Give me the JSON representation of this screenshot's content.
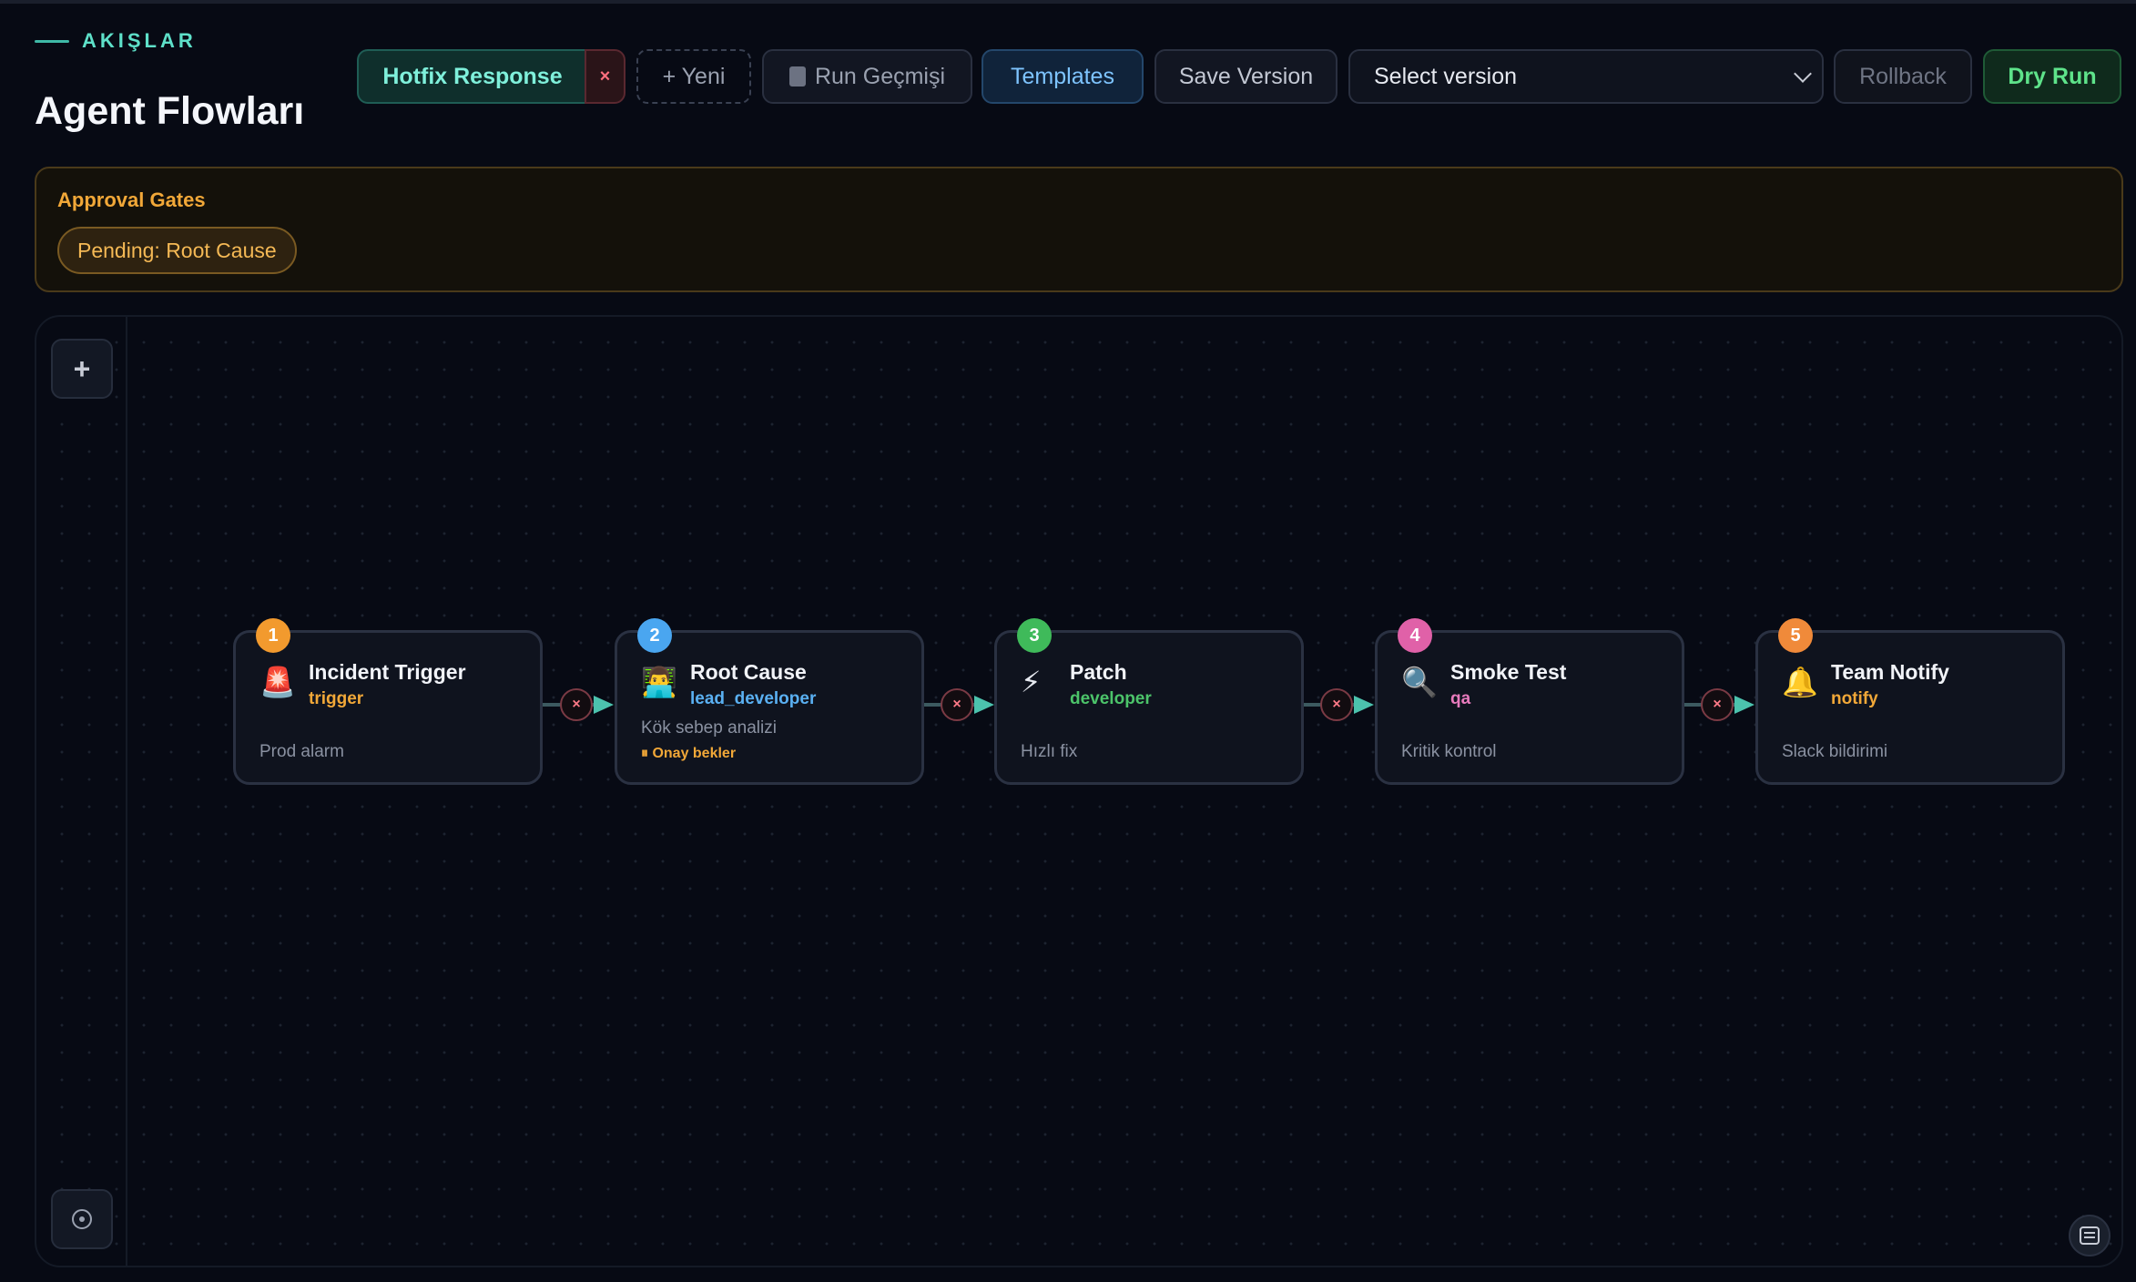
{
  "header": {
    "eyebrow": "AKIŞLAR",
    "title": "Agent Flowları"
  },
  "toolbar": {
    "active_flow": "Hotfix Response",
    "close_flow": "×",
    "new_label": "+ Yeni",
    "history_label": "Run Geçmişi",
    "templates_label": "Templates",
    "save_version_label": "Save Version",
    "select_version": "Select version",
    "rollback_label": "Rollback",
    "dry_run_label": "Dry Run"
  },
  "approval_gates": {
    "title": "Approval Gates",
    "pending": [
      "Pending: Root Cause"
    ]
  },
  "canvas": {
    "add_label": "+",
    "edge_delete_label": "×"
  },
  "nodes": [
    {
      "index": "1",
      "icon": "siren-icon",
      "emoji": "🚨",
      "title": "Incident Trigger",
      "role": "trigger",
      "desc": "Prod alarm",
      "status": "",
      "badge_color": "#f29a2e",
      "role_color": "#f2a838"
    },
    {
      "index": "2",
      "icon": "technologist-icon",
      "emoji": "👨‍💻",
      "title": "Root Cause",
      "role": "lead_developer",
      "desc": "Kök sebep analizi",
      "status": "⏸ Onay bekler",
      "badge_color": "#4aa6f0",
      "role_color": "#5ab0f2"
    },
    {
      "index": "3",
      "icon": "lightning-icon",
      "emoji": "⚡",
      "title": "Patch",
      "role": "developer",
      "desc": "Hızlı fix",
      "status": "",
      "badge_color": "#3fba5a",
      "role_color": "#4cc46a"
    },
    {
      "index": "4",
      "icon": "magnifier-icon",
      "emoji": "🔍",
      "title": "Smoke Test",
      "role": "qa",
      "desc": "Kritik kontrol",
      "status": "",
      "badge_color": "#e061a8",
      "role_color": "#e87bbd"
    },
    {
      "index": "5",
      "icon": "bell-icon",
      "emoji": "🔔",
      "title": "Team Notify",
      "role": "notify",
      "desc": "Slack bildirimi",
      "status": "",
      "badge_color": "#f08a3a",
      "role_color": "#f2a838"
    }
  ]
}
